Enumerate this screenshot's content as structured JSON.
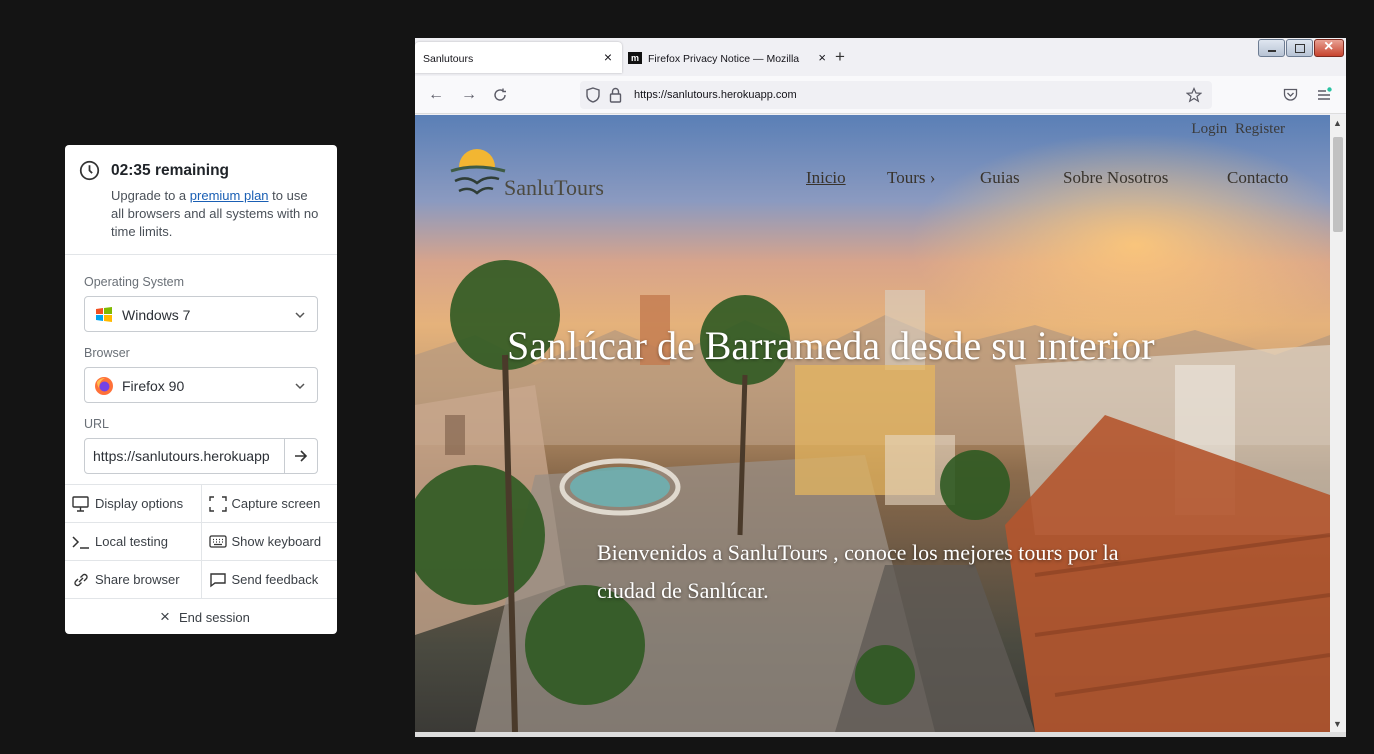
{
  "session": {
    "time_remaining": "02:35 remaining",
    "upgrade_prefix": "Upgrade to a ",
    "upgrade_link": "premium plan",
    "upgrade_suffix": " to use all browsers and all systems with no time limits.",
    "os_label": "Operating System",
    "os_value": "Windows 7",
    "browser_label": "Browser",
    "browser_value": "Firefox 90",
    "url_label": "URL",
    "url_value": "https://sanlutours.herokuapp",
    "actions": {
      "display_options": "Display options",
      "capture_screen": "Capture screen",
      "local_testing": "Local testing",
      "show_keyboard": "Show keyboard",
      "share_browser": "Share browser",
      "send_feedback": "Send feedback",
      "end_session": "End session"
    }
  },
  "browser": {
    "tabs": [
      {
        "title": "Sanlutours",
        "close": "×"
      },
      {
        "favicon": "m",
        "title": "Firefox Privacy Notice — Mozilla",
        "close": "×"
      }
    ],
    "new_tab": "+",
    "url": "https://sanlutours.herokuapp.com"
  },
  "site": {
    "auth": "Login Register",
    "logo_text": "SanluTours",
    "nav": {
      "inicio": "Inicio",
      "tours": "Tours ›",
      "guias": "Guias",
      "sobre": "Sobre Nosotros",
      "contacto": "Contacto"
    },
    "hero_title": "Sanlúcar de Barrameda desde su interior",
    "hero_subtitle": "Bienvenidos a SanluTours , conoce los mejores tours por la ciudad de Sanlúcar."
  },
  "colors": {
    "link": "#1a5fb4",
    "backdrop": "#141414"
  }
}
